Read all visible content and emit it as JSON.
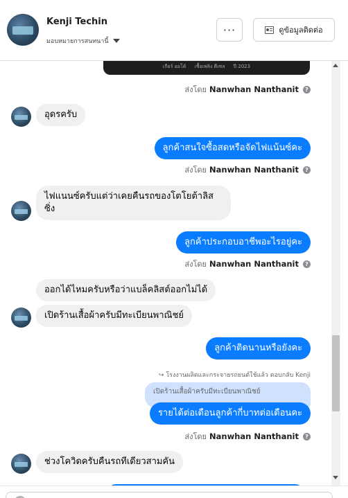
{
  "header": {
    "name": "Kenji Techin",
    "assign_label": "มอบหมายการสนทนานี้",
    "more_label": "···",
    "contact_button": "ดูข้อมูลติดต่อ"
  },
  "card": {
    "info1": "เกียร์ ออโต้",
    "info2": "เชื้อเพลิง ดีเซล",
    "info3": "ปี 2023"
  },
  "sent_by_prefix": "ส่งโดย",
  "sender_name": "Nanwhan Nanthanit",
  "messages": {
    "m1": "อุดรครับ",
    "m2": "ลูกค้าสนใจซื้อสดหรือจัดไฟแน้นซ์คะ",
    "m3": "ไฟแนนซ์ครับแต่ว่าเคยคืนรถของโตโยต้าลิสซิ่ง",
    "m4": "ลูกค้าประกอบอาชีพอะไรอยู่คะ",
    "m5": "ออกได้ไหมครับหรือว่าแบล็คลิสต์ออกไม่ได้",
    "m6": "เปิดร้านเสื้อผ้าครับมีทะเบียนพาณิชย์",
    "m7": "ลูกค้าติดนานหรือยังคะ",
    "reply_note": "โรงงานผลิตและกระจายรถยนต์ใช้แล้ว ตอบกลับ Kenji",
    "quoted": "เปิดร้านเสื้อผ้าครับมีทะเบียนพาณิชย์",
    "m8": "รายได้ต่อเดือนลูกค้ากี่บาทต่อเดือนคะ",
    "m9": "ช่วงโควิดครับคืนรถทีเดียวสามคัน"
  },
  "colors": {
    "outgoing_bubble": "#0a7cff",
    "incoming_bubble": "#f0f0f0",
    "quoted_bg": "#cfe1fc"
  }
}
